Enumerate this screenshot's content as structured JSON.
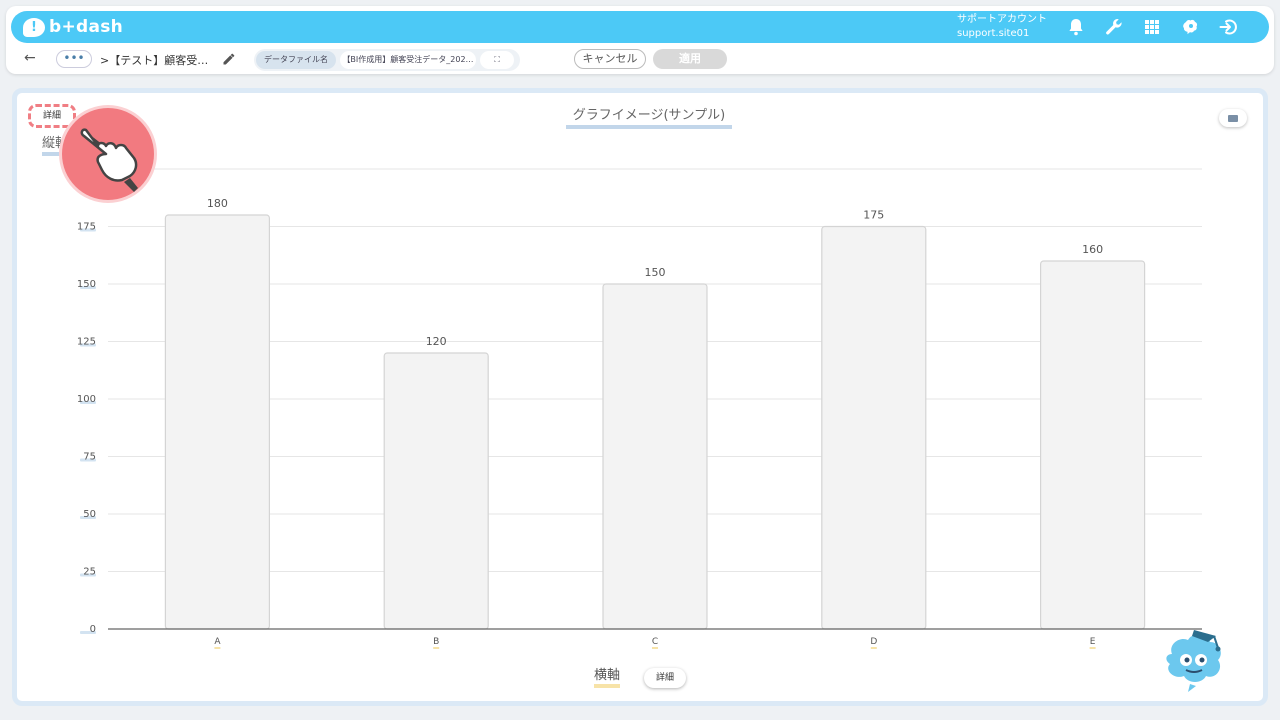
{
  "app": {
    "brand": "b+dash",
    "account_label": "サポートアカウント",
    "account_id": "support.site01",
    "accent_color": "#4cc9f6"
  },
  "toolbar": {
    "more": "•••",
    "breadcrumb": ">【テスト】顧客受…",
    "file_label": "データファイル名",
    "file_name": "【BI作成用】顧客受注データ_202…",
    "expand": "⛶",
    "cancel": "キャンセル",
    "apply": "適用"
  },
  "chart_ui": {
    "detail_label": "詳細",
    "y_axis_title": "縦軸",
    "x_axis_title": "横軸"
  },
  "icons": [
    "back-arrow-icon",
    "pencil-icon",
    "bell-icon",
    "wrench-icon",
    "grid-icon",
    "brain-icon",
    "logout-icon",
    "pointing-hand-icon",
    "mascot-icon"
  ],
  "chart_data": {
    "type": "bar",
    "title": "グラフイメージ(サンプル)",
    "categories": [
      "A",
      "B",
      "C",
      "D",
      "E"
    ],
    "values": [
      180,
      120,
      150,
      175,
      160
    ],
    "ylim": [
      0,
      200
    ],
    "yticks": [
      0,
      25,
      50,
      75,
      100,
      125,
      150,
      175
    ],
    "xlabel": "横軸",
    "ylabel": "縦軸",
    "grid": true,
    "bar_color": "#f3f3f3",
    "bar_border": "#d4d4d4"
  }
}
